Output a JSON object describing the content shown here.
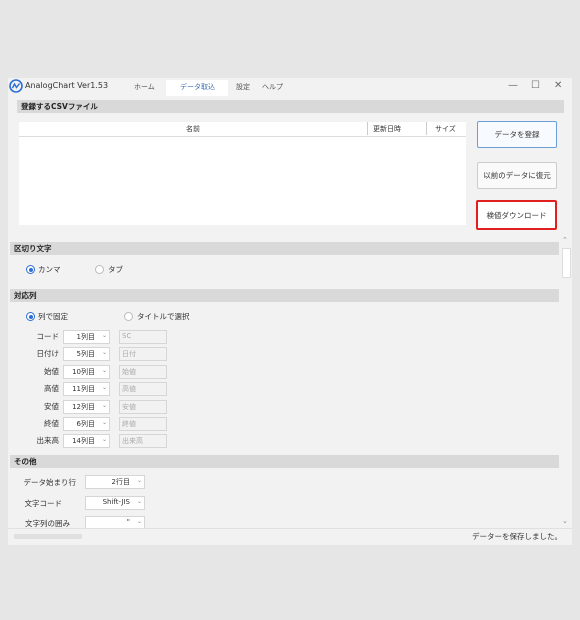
{
  "app": {
    "title": "AnalogChart Ver1.53"
  },
  "tabs": [
    {
      "label": "ホーム"
    },
    {
      "label": "データ取込"
    },
    {
      "label": "設定"
    },
    {
      "label": "ヘルプ"
    }
  ],
  "window_controls": {
    "minimize": "—",
    "maximize": "☐",
    "close": "✕"
  },
  "csv_section": {
    "title": "登録するCSVファイル",
    "columns": [
      "名前",
      "更新日時",
      "サイズ"
    ],
    "rows": []
  },
  "buttons": {
    "register": "データを登録",
    "restore": "以前のデータに復元",
    "sample": "検値ダウンロード"
  },
  "delimiter": {
    "title": "区切り文字",
    "options": [
      {
        "label": "カンマ",
        "selected": true
      },
      {
        "label": "タブ",
        "selected": false
      }
    ]
  },
  "mapping": {
    "title": "対応列",
    "modes": [
      {
        "label": "列で固定",
        "selected": true
      },
      {
        "label": "タイトルで選択",
        "selected": false
      }
    ],
    "rows": [
      {
        "label": "コード",
        "column": "1列目",
        "title": "SC"
      },
      {
        "label": "日付け",
        "column": "5列目",
        "title": "日付"
      },
      {
        "label": "始値",
        "column": "10列目",
        "title": "始値"
      },
      {
        "label": "高値",
        "column": "11列目",
        "title": "高値"
      },
      {
        "label": "安値",
        "column": "12列目",
        "title": "安値"
      },
      {
        "label": "終値",
        "column": "6列目",
        "title": "終値"
      },
      {
        "label": "出来高",
        "column": "14列目",
        "title": "出来高"
      }
    ]
  },
  "other": {
    "title": "その他",
    "rows": [
      {
        "label": "データ始まり行",
        "value": "2行目"
      },
      {
        "label": "文字コード",
        "value": "Shift-JIS"
      },
      {
        "label": "文字列の囲み",
        "value": "\""
      }
    ]
  },
  "status": {
    "text": "データーを保存しました。"
  },
  "colors": {
    "accent": "#2b6fd6",
    "highlight": "#e02020",
    "section": "#d9d9d9"
  },
  "icons": {
    "logo": "analogchart-logo-icon",
    "dropdown": "chevron-down-icon"
  }
}
